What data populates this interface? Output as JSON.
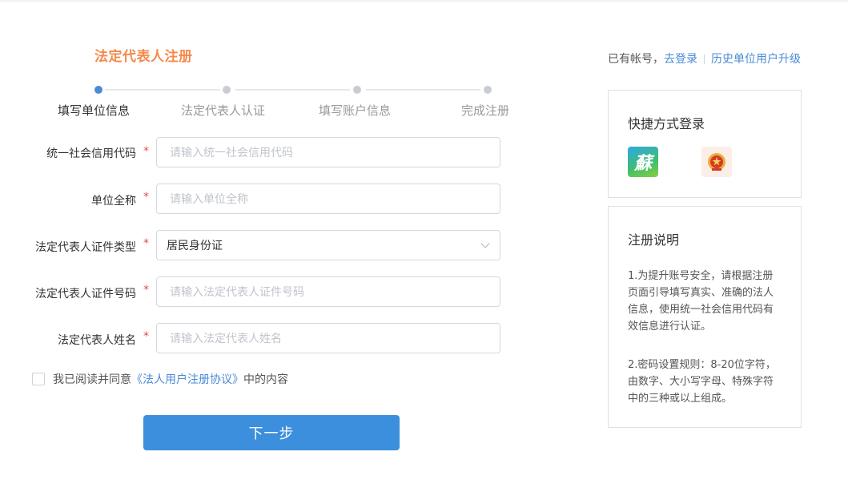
{
  "header": {
    "title": "法定代表人注册",
    "has_account_text": "已有帐号，",
    "login_link": "去登录",
    "upgrade_link": "历史单位用户升级"
  },
  "steps": [
    {
      "label": "填写单位信息",
      "active": true
    },
    {
      "label": "法定代表人认证",
      "active": false
    },
    {
      "label": "填写账户信息",
      "active": false
    },
    {
      "label": "完成注册",
      "active": false
    }
  ],
  "form": {
    "required_mark": "*",
    "fields": [
      {
        "label": "统一社会信用代码",
        "placeholder": "请输入统一社会信用代码"
      },
      {
        "label": "单位全称",
        "placeholder": "请输入单位全称"
      },
      {
        "label": "法定代表人证件类型",
        "value": "居民身份证"
      },
      {
        "label": "法定代表人证件号码",
        "placeholder": "请输入法定代表人证件号码"
      },
      {
        "label": "法定代表人姓名",
        "placeholder": "请输入法定代表人姓名"
      }
    ],
    "agree_prefix": "我已阅读并同意",
    "agree_link": "《法人用户注册协议》",
    "agree_suffix": "中的内容",
    "next_button": "下一步"
  },
  "sidebar": {
    "quick_login_title": "快捷方式登录",
    "quick_login_icons": [
      "su-app-icon",
      "national-emblem-icon"
    ],
    "su_glyph": "蘇",
    "instructions_title": "注册说明",
    "instructions": [
      "1.为提升账号安全，请根据注册页面引导填写真实、准确的法人信息，使用统一社会信用代码有效信息进行认证。",
      "2.密码设置规则：8-20位字符，由数字、大小写字母、特殊字符中的三种或以上组成。"
    ]
  },
  "colors": {
    "title": "#f5894a",
    "accent": "#4a8bd6",
    "button": "#3c8fdc",
    "required": "#e05050"
  }
}
